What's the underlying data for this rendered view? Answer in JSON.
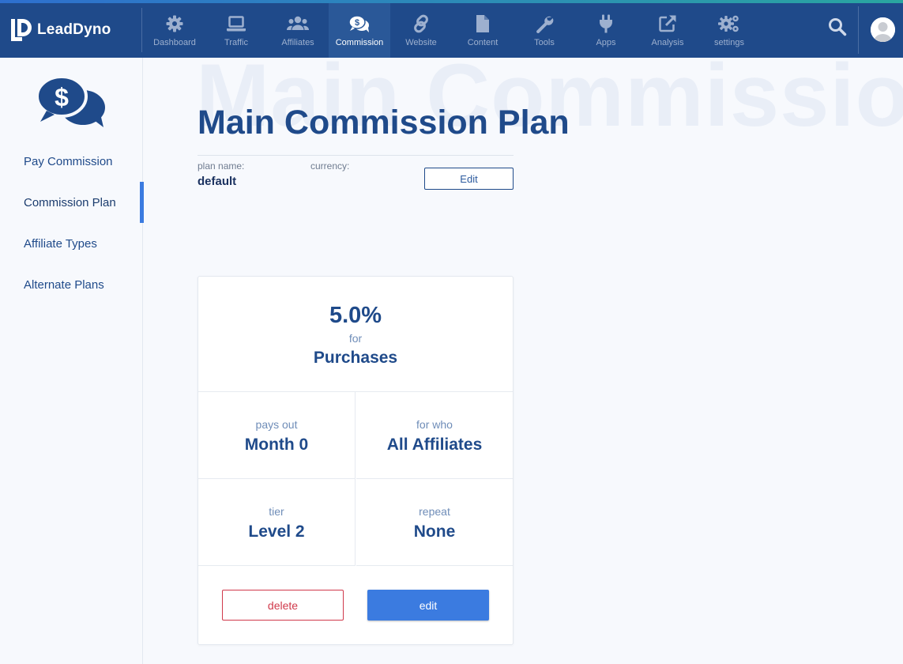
{
  "app": {
    "name": "LeadDyno"
  },
  "nav": [
    {
      "label": "Dashboard",
      "icon": "gear-icon"
    },
    {
      "label": "Traffic",
      "icon": "laptop-icon"
    },
    {
      "label": "Affiliates",
      "icon": "users-icon"
    },
    {
      "label": "Commission",
      "icon": "dollar-chat-icon",
      "active": true
    },
    {
      "label": "Website",
      "icon": "link-icon"
    },
    {
      "label": "Content",
      "icon": "document-icon"
    },
    {
      "label": "Tools",
      "icon": "wrench-icon"
    },
    {
      "label": "Apps",
      "icon": "plug-icon"
    },
    {
      "label": "Analysis",
      "icon": "external-link-icon"
    },
    {
      "label": "settings",
      "icon": "gears-icon"
    }
  ],
  "sidebar": {
    "items": [
      {
        "label": "Pay Commission"
      },
      {
        "label": "Commission Plan",
        "active": true
      },
      {
        "label": "Affiliate Types"
      },
      {
        "label": "Alternate Plans"
      }
    ]
  },
  "page": {
    "watermark": "Main Commissio",
    "title": "Main Commission Plan",
    "plan_name_label": "plan name:",
    "plan_name_value": "default",
    "currency_label": "currency:",
    "currency_value": "",
    "edit_label": "Edit"
  },
  "card": {
    "rate": "5.0%",
    "for_label": "for",
    "event": "Purchases",
    "pays_out_label": "pays out",
    "pays_out_value": "Month 0",
    "for_who_label": "for who",
    "for_who_value": "All Affiliates",
    "tier_label": "tier",
    "tier_value": "Level 2",
    "repeat_label": "repeat",
    "repeat_value": "None",
    "delete_label": "delete",
    "edit_label": "edit"
  },
  "colors": {
    "navbar": "#1f4a8a",
    "accent": "#3b7be0",
    "danger": "#d0394b",
    "title": "#1f4a8a"
  }
}
